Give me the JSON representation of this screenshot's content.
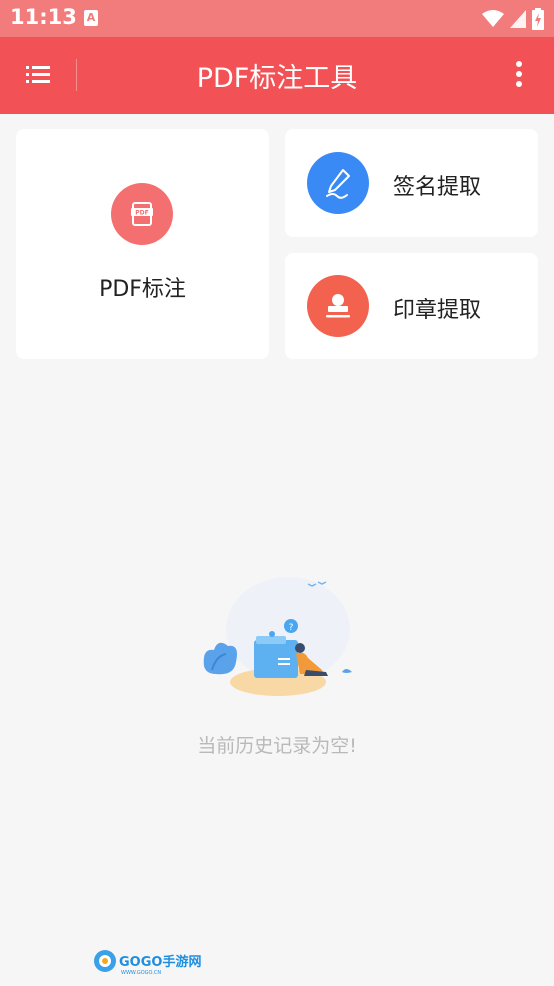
{
  "status_bar": {
    "time": "11:13",
    "notification_badge": "A"
  },
  "app_bar": {
    "title": "PDF标注工具",
    "menu_icon": "list-menu-icon",
    "more_icon": "more-vertical-icon"
  },
  "features": {
    "pdf_annotate": {
      "label": "PDF标注",
      "icon": "pdf-file-icon",
      "color": "#f47070"
    },
    "signature_extract": {
      "label": "签名提取",
      "icon": "pen-sign-icon",
      "color": "#3a8af5"
    },
    "stamp_extract": {
      "label": "印章提取",
      "icon": "stamp-icon",
      "color": "#f2624e"
    }
  },
  "history": {
    "empty_message": "当前历史记录为空!"
  },
  "watermark": {
    "brand": "GOGO手游网",
    "url": "WWW.GOGO.CN"
  },
  "colors": {
    "status_bar": "#f27b7b",
    "app_bar": "#f25255",
    "background": "#f6f6f6"
  }
}
